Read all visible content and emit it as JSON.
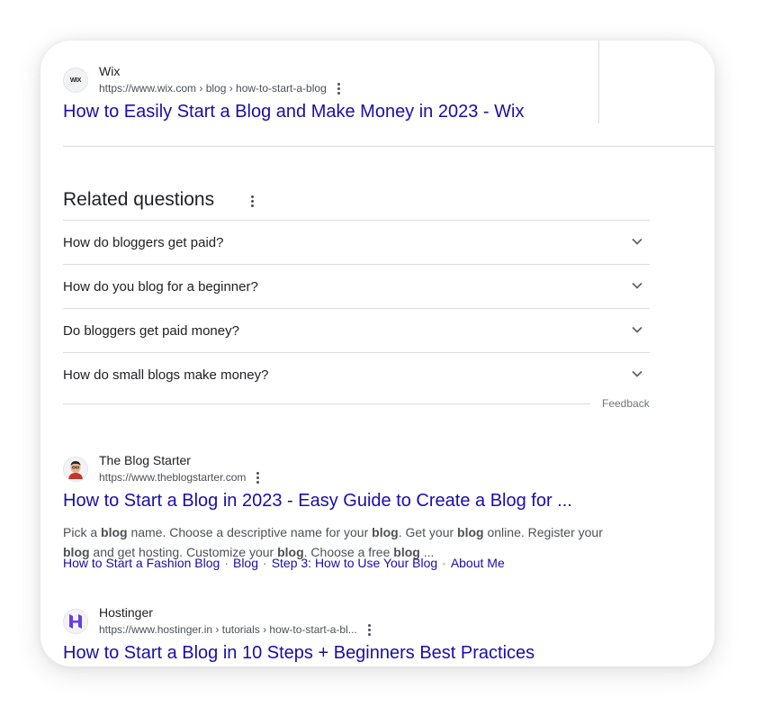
{
  "results": [
    {
      "site_name": "Wix",
      "favicon_text": "WIX",
      "url": "https://www.wix.com › blog › how-to-start-a-blog",
      "title": "How to Easily Start a Blog and Make Money in 2023 - Wix"
    },
    {
      "site_name": "The Blog Starter",
      "url": "https://www.theblogstarter.com",
      "title": "How to Start a Blog in 2023 - Easy Guide to Create a Blog for ...",
      "snippet_parts": [
        {
          "t": "Pick a ",
          "b": false
        },
        {
          "t": "blog",
          "b": true
        },
        {
          "t": " name. Choose a descriptive name for your ",
          "b": false
        },
        {
          "t": "blog",
          "b": true
        },
        {
          "t": ". Get your ",
          "b": false
        },
        {
          "t": "blog",
          "b": true
        },
        {
          "t": " online. Register your ",
          "b": false
        },
        {
          "t": "blog",
          "b": true
        },
        {
          "t": " and get hosting. Customize your ",
          "b": false
        },
        {
          "t": "blog",
          "b": true
        },
        {
          "t": ". Choose a free ",
          "b": false
        },
        {
          "t": "blog",
          "b": true
        },
        {
          "t": " ...",
          "b": false
        }
      ],
      "sitelinks": [
        "How to Start a Fashion Blog",
        "Blog",
        "Step 3: How to Use Your Blog",
        "About Me"
      ]
    },
    {
      "site_name": "Hostinger",
      "url": "https://www.hostinger.in › tutorials › how-to-start-a-bl...",
      "title": "How to Start a Blog in 10 Steps + Beginners Best Practices"
    }
  ],
  "related_questions": {
    "heading": "Related questions",
    "items": [
      "How do bloggers get paid?",
      "How do you blog for a beginner?",
      "Do bloggers get paid money?",
      "How do small blogs make money?"
    ],
    "feedback": "Feedback"
  },
  "sitelink_separator": "·",
  "colors": {
    "link": "#1a0dab",
    "text": "#202124",
    "muted": "#4d5156",
    "divider": "#dadce0",
    "hostinger": "#673de6"
  }
}
